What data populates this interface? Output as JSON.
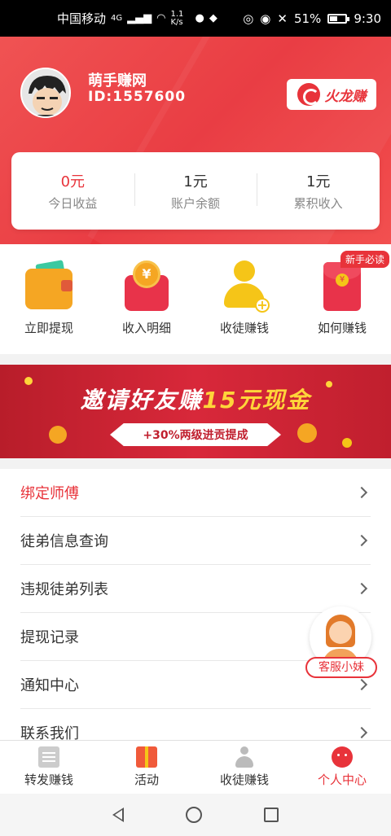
{
  "status_bar": {
    "carrier": "中国移动",
    "net_type": "4G",
    "speed": "1.1 K/s",
    "battery": "51%",
    "battery_level": 0.51,
    "time": "9:30"
  },
  "profile": {
    "name": "萌手赚网",
    "id": "ID:1557600",
    "brand_label": "火龙赚"
  },
  "stats": [
    {
      "value": "0元",
      "label": "今日收益",
      "highlight": true
    },
    {
      "value": "1元",
      "label": "账户余额",
      "highlight": false
    },
    {
      "value": "1元",
      "label": "累积收入",
      "highlight": false
    }
  ],
  "shortcuts": [
    {
      "label": "立即提现",
      "icon": "wallet-icon"
    },
    {
      "label": "收入明细",
      "icon": "coin-purse-icon"
    },
    {
      "label": "收徒赚钱",
      "icon": "add-person-icon"
    },
    {
      "label": "如何赚钱",
      "icon": "red-packet-icon",
      "tag": "新手必读"
    }
  ],
  "banner": {
    "title_part1": "邀请好友赚",
    "title_highlight": "15元现金",
    "subtitle": "+30%两级进贡提成"
  },
  "menu": [
    {
      "label": "绑定师傅",
      "highlight": true
    },
    {
      "label": "徒弟信息查询",
      "highlight": false
    },
    {
      "label": "违规徒弟列表",
      "highlight": false
    },
    {
      "label": "提现记录",
      "highlight": false
    },
    {
      "label": "通知中心",
      "highlight": false
    },
    {
      "label": "联系我们",
      "highlight": false
    }
  ],
  "customer_service": {
    "label": "客服小妹"
  },
  "tabbar": [
    {
      "label": "转发赚钱",
      "icon": "news-icon",
      "active": false
    },
    {
      "label": "活动",
      "icon": "gift-icon",
      "active": false
    },
    {
      "label": "收徒赚钱",
      "icon": "user-icon",
      "active": false
    },
    {
      "label": "个人中心",
      "icon": "profile-face-icon",
      "active": true
    }
  ],
  "colors": {
    "accent": "#e8333a",
    "banner_highlight": "#ffd53a"
  }
}
